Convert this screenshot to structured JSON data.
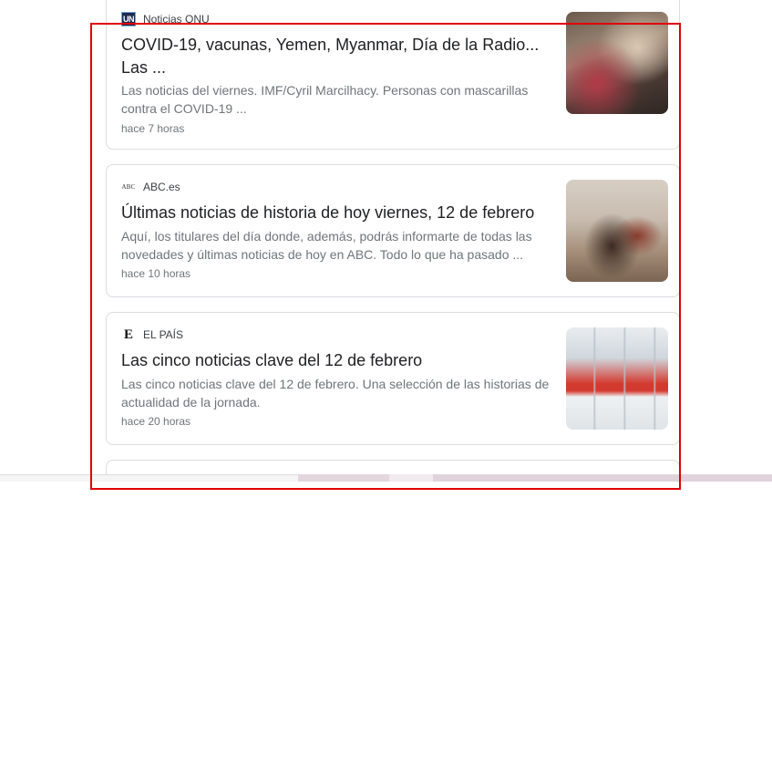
{
  "cards": [
    {
      "source": "Noticias ONU",
      "icon": "un-logo-icon",
      "icon_text": "UN",
      "headline": "COVID-19, vacunas, Yemen, Myanmar, Día de la Radio... Las ...",
      "snippet": "Las noticias del viernes. IMF/Cyril Marcilhacy. Personas con mascarillas contra el COVID-19 ...",
      "time": "hace 7 horas",
      "thumbnail": "market-photo"
    },
    {
      "source": "ABC.es",
      "icon": "abc-logo-icon",
      "icon_text": "ABC",
      "headline": "Últimas noticias de historia de hoy viernes, 12 de febrero",
      "snippet": "Aquí, los titulares del día donde, además, podrás informarte de todas las novedades y últimas noticias de hoy en ABC. Todo lo que ha pasado ...",
      "time": "hace 10 horas",
      "thumbnail": "battle-painting"
    },
    {
      "source": "EL PAÍS",
      "icon": "elpais-logo-icon",
      "icon_text": "E",
      "headline": "Las cinco noticias clave del 12 de febrero",
      "snippet": "Las cinco noticias clave del 12 de febrero. Una selección de las historias de actualidad de la jornada.",
      "time": "hace 20 horas",
      "thumbnail": "vaccine-vials"
    }
  ],
  "colors": {
    "highlight_frame": "#e00000",
    "card_border": "#dadce0",
    "snippet_text": "#70757a"
  }
}
